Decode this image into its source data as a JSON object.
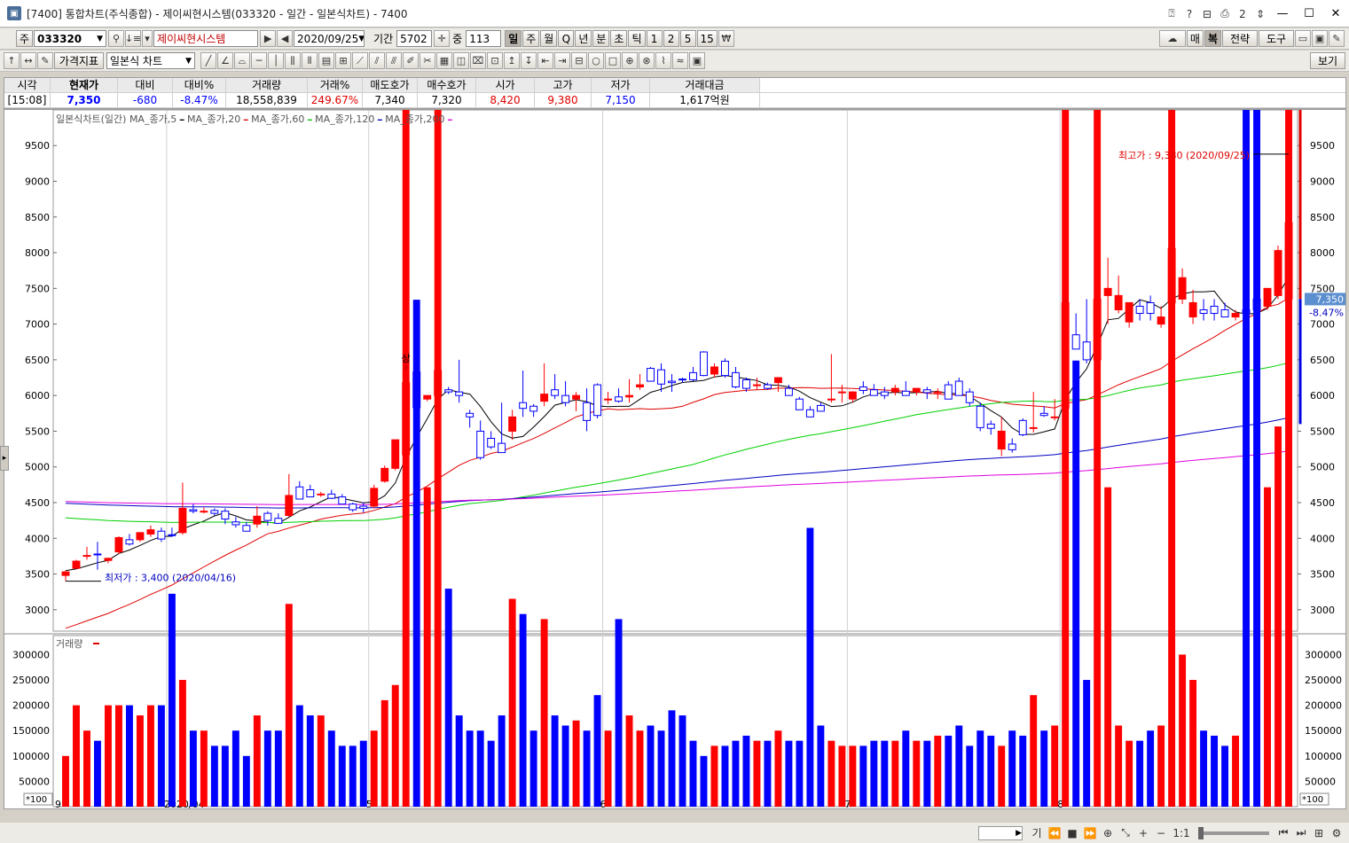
{
  "window": {
    "title": "[7400] 통합차트(주식종합) - 제이씨현시스템(033320 - 일간 - 일본식차트) - 7400",
    "right_icons": [
      "?",
      "?",
      "ㅁ",
      "2",
      "↕"
    ]
  },
  "toolbar1": {
    "type_label": "주",
    "code": "033320",
    "stock_name": "제이씨현시스템",
    "date": "2020/09/25",
    "period_label": "기간",
    "period_value": "5702",
    "count_label": "중",
    "count_value": "113",
    "intervals": [
      "일",
      "주",
      "월",
      "Q",
      "년",
      "분",
      "초",
      "틱",
      "1",
      "2",
      "5",
      "15"
    ],
    "selected_interval": "일",
    "right_buttons": [
      "매",
      "복",
      "전략",
      "도구"
    ]
  },
  "toolbar2": {
    "indicator_button": "가격지표",
    "chart_type": "일본식 차트",
    "view_button": "보기"
  },
  "quote": {
    "headers": [
      "시각",
      "현재가",
      "대비",
      "대비%",
      "거래량",
      "거래%",
      "매도호가",
      "매수호가",
      "시가",
      "고가",
      "저가",
      "거래대금"
    ],
    "values": [
      "[15:08]",
      "7,350",
      "-680",
      "-8.47%",
      "18,558,839",
      "249.67%",
      "7,340",
      "7,320",
      "8,420",
      "9,380",
      "7,150",
      "1,617억원"
    ]
  },
  "chart": {
    "legend_title": "일본식차트(일간)",
    "legend_items": [
      {
        "label": "MA_종가,5",
        "color": "#000000"
      },
      {
        "label": "MA_종가,20",
        "color": "#e00000"
      },
      {
        "label": "MA_종가,60",
        "color": "#00c000"
      },
      {
        "label": "MA_종가,120",
        "color": "#0000c0"
      },
      {
        "label": "MA_종가,200",
        "color": "#e000e0"
      }
    ],
    "high_annotation": "최고가 : 9,380 (2020/09/25)",
    "low_annotation": "최저가 : 3,400 (2020/04/16)",
    "limit_up_mark": "상",
    "current_price_tag": "7,350",
    "current_change_tag": "-8.47%",
    "volume_title": "거래량",
    "volume_tag": "18,558K",
    "volume_pct_tag": "249.67%",
    "volume_unit": "*100",
    "x_labels": [
      "2020/04",
      "5",
      "6",
      "7",
      "8",
      "9"
    ],
    "price_ticks": [
      "9500",
      "9000",
      "8500",
      "8000",
      "7500",
      "7000",
      "6500",
      "6000",
      "5500",
      "5000",
      "4500",
      "4000",
      "3500",
      "3000"
    ],
    "volume_ticks": [
      "300000",
      "250000",
      "200000",
      "150000",
      "100000",
      "50000"
    ]
  },
  "chart_data": {
    "type": "candlestick",
    "ylim": [
      2700,
      9900
    ],
    "volume_ylim": [
      0,
      320000
    ],
    "up_color": "#ff0000",
    "down_color": "#0000ff",
    "month_starts": {
      "2020/04": 0,
      "5": 10,
      "6": 29,
      "7": 51,
      "8": 74,
      "9": 94
    },
    "ohlc": [
      [
        3480,
        3550,
        3400,
        3530
      ],
      [
        3580,
        3700,
        3580,
        3680
      ],
      [
        3750,
        3880,
        3700,
        3760
      ],
      [
        3780,
        3950,
        3560,
        3770
      ],
      [
        3690,
        3730,
        3650,
        3720
      ],
      [
        3810,
        4030,
        3780,
        4010
      ],
      [
        3980,
        4060,
        3900,
        3920
      ],
      [
        3980,
        4080,
        3950,
        4080
      ],
      [
        4060,
        4180,
        4020,
        4120
      ],
      [
        4100,
        4150,
        3950,
        3990
      ],
      [
        4050,
        4150,
        4020,
        4040
      ],
      [
        4080,
        4780,
        4050,
        4420
      ],
      [
        4400,
        4480,
        4350,
        4380
      ],
      [
        4380,
        4430,
        4350,
        4380
      ],
      [
        4390,
        4420,
        4320,
        4350
      ],
      [
        4380,
        4420,
        4200,
        4270
      ],
      [
        4230,
        4300,
        4150,
        4190
      ],
      [
        4180,
        4230,
        4100,
        4100
      ],
      [
        4200,
        4450,
        4150,
        4310
      ],
      [
        4350,
        4380,
        4180,
        4250
      ],
      [
        4280,
        4350,
        4200,
        4210
      ],
      [
        4320,
        4900,
        4300,
        4600
      ],
      [
        4720,
        4800,
        4550,
        4550
      ],
      [
        4680,
        4750,
        4580,
        4580
      ],
      [
        4620,
        4650,
        4580,
        4620
      ],
      [
        4620,
        4680,
        4550,
        4560
      ],
      [
        4580,
        4620,
        4480,
        4480
      ],
      [
        4480,
        4500,
        4370,
        4400
      ],
      [
        4450,
        4500,
        4360,
        4420
      ],
      [
        4450,
        4750,
        4420,
        4700
      ],
      [
        4800,
        5020,
        4780,
        4980
      ],
      [
        4980,
        5380,
        4950,
        5380
      ],
      [
        5170,
        6250,
        5100,
        6180
      ],
      [
        6330,
        6400,
        5800,
        5830
      ],
      [
        5950,
        6000,
        5920,
        6000
      ],
      [
        6000,
        7120,
        5950,
        6350
      ],
      [
        6080,
        6120,
        6020,
        6050
      ],
      [
        6050,
        6500,
        5900,
        6000
      ],
      [
        5750,
        5800,
        5550,
        5700
      ],
      [
        5500,
        5650,
        5100,
        5130
      ],
      [
        5400,
        5500,
        5250,
        5280
      ],
      [
        5330,
        5900,
        5200,
        5200
      ],
      [
        5500,
        5800,
        5380,
        5700
      ],
      [
        5900,
        6350,
        5700,
        5820
      ],
      [
        5850,
        5880,
        5700,
        5780
      ],
      [
        5920,
        6450,
        5850,
        6020
      ],
      [
        6080,
        6300,
        5950,
        6000
      ],
      [
        6000,
        6200,
        5850,
        5900
      ],
      [
        5950,
        6050,
        5780,
        6000
      ],
      [
        5900,
        6100,
        5500,
        5650
      ],
      [
        6150,
        6170,
        5680,
        5720
      ],
      [
        5950,
        6050,
        5880,
        5950
      ],
      [
        5980,
        6100,
        5900,
        5920
      ],
      [
        5980,
        6230,
        5900,
        6000
      ],
      [
        6120,
        6300,
        6080,
        6150
      ],
      [
        6380,
        6400,
        6200,
        6200
      ],
      [
        6360,
        6450,
        6050,
        6160
      ],
      [
        6200,
        6300,
        6050,
        6180
      ],
      [
        6230,
        6250,
        6180,
        6220
      ],
      [
        6320,
        6400,
        6200,
        6220
      ],
      [
        6610,
        6620,
        6270,
        6280
      ],
      [
        6300,
        6450,
        6250,
        6400
      ],
      [
        6480,
        6520,
        6250,
        6280
      ],
      [
        6320,
        6400,
        6100,
        6120
      ],
      [
        6220,
        6250,
        6050,
        6100
      ],
      [
        6150,
        6250,
        6080,
        6150
      ],
      [
        6150,
        6180,
        6080,
        6100
      ],
      [
        6180,
        6250,
        6050,
        6250
      ],
      [
        6100,
        6150,
        6050,
        6000
      ],
      [
        5950,
        5980,
        5850,
        5800
      ],
      [
        5800,
        5850,
        5700,
        5700
      ],
      [
        5860,
        5900,
        5780,
        5780
      ],
      [
        5950,
        6580,
        5900,
        5950
      ],
      [
        6050,
        6150,
        5900,
        6050
      ],
      [
        5950,
        6060,
        5900,
        6050
      ],
      [
        6120,
        6200,
        6020,
        6070
      ],
      [
        6080,
        6160,
        6000,
        6000
      ],
      [
        6050,
        6120,
        5950,
        6000
      ],
      [
        6050,
        6150,
        6000,
        6100
      ],
      [
        6060,
        6200,
        6030,
        6000
      ],
      [
        6050,
        6100,
        6000,
        6100
      ],
      [
        6080,
        6120,
        5950,
        6040
      ],
      [
        6050,
        6100,
        5950,
        6050
      ],
      [
        6150,
        6200,
        5950,
        5950
      ],
      [
        6200,
        6250,
        6000,
        6000
      ],
      [
        6050,
        6100,
        5850,
        5900
      ],
      [
        5850,
        5900,
        5500,
        5550
      ],
      [
        5600,
        5650,
        5450,
        5540
      ],
      [
        5250,
        5700,
        5150,
        5500
      ],
      [
        5320,
        5400,
        5200,
        5240
      ],
      [
        5650,
        5680,
        5430,
        5450
      ],
      [
        5550,
        6050,
        5480,
        5550
      ],
      [
        5750,
        5850,
        5700,
        5720
      ],
      [
        5700,
        5950,
        5650,
        5700
      ],
      [
        5820,
        7520,
        5750,
        7300
      ],
      [
        6850,
        7150,
        6750,
        6650
      ],
      [
        6750,
        7350,
        6450,
        6500
      ],
      [
        6500,
        8070,
        6450,
        7350
      ],
      [
        7400,
        7930,
        7000,
        7500
      ],
      [
        7200,
        7680,
        7150,
        7400
      ],
      [
        7030,
        7250,
        6950,
        7300
      ],
      [
        7250,
        7350,
        7050,
        7150
      ],
      [
        7300,
        7400,
        7050,
        7150
      ],
      [
        7000,
        7250,
        6950,
        7100
      ],
      [
        7300,
        8750,
        7150,
        8060
      ],
      [
        7350,
        7780,
        7280,
        7650
      ],
      [
        7100,
        7480,
        7000,
        7300
      ],
      [
        7200,
        7350,
        7050,
        7150
      ],
      [
        7250,
        7350,
        7050,
        7150
      ],
      [
        7200,
        7300,
        7100,
        7100
      ],
      [
        7100,
        7200,
        7050,
        7150
      ],
      [
        7200,
        8670,
        7100,
        7150
      ],
      [
        7350,
        7600,
        6750,
        7200
      ],
      [
        7250,
        7500,
        7200,
        7500
      ],
      [
        7400,
        8100,
        7350,
        8030
      ],
      [
        7350,
        9380,
        7150,
        8420
      ]
    ],
    "volume": [
      1000,
      2000,
      1500,
      1300,
      2000,
      2000,
      2000,
      1800,
      2000,
      2000,
      4200,
      2500,
      1500,
      1500,
      1200,
      1200,
      1500,
      1000,
      1800,
      1500,
      1500,
      4000,
      2000,
      1800,
      1800,
      1500,
      1200,
      1200,
      1300,
      1500,
      2100,
      2400,
      24500,
      10000,
      6300,
      27400,
      4300,
      1800,
      1500,
      1500,
      1300,
      1800,
      4100,
      3800,
      1500,
      3700,
      1800,
      1600,
      1700,
      1500,
      2200,
      1500,
      3700,
      1800,
      1500,
      1600,
      1500,
      1900,
      1800,
      1300,
      1000,
      1200,
      1200,
      1300,
      1400,
      1300,
      1300,
      1500,
      1300,
      1300,
      5500,
      1600,
      1300,
      1200,
      1200,
      1200,
      1300,
      1300,
      1300,
      1500,
      1300,
      1300,
      1400,
      1400,
      1600,
      1200,
      1500,
      1400,
      1200,
      1500,
      1400,
      2200,
      1500,
      1600,
      24800,
      8800,
      2500,
      30600,
      6300,
      1600,
      1300,
      1300,
      1500,
      1600,
      16500,
      3000,
      2500,
      1500,
      1400,
      1200,
      1400,
      25500,
      17200,
      6300,
      7500,
      18558
    ],
    "ma5_start": 1,
    "ma20_start": 0,
    "ma60_start": 0,
    "ma120_start": 0,
    "ma200_start": 0
  }
}
